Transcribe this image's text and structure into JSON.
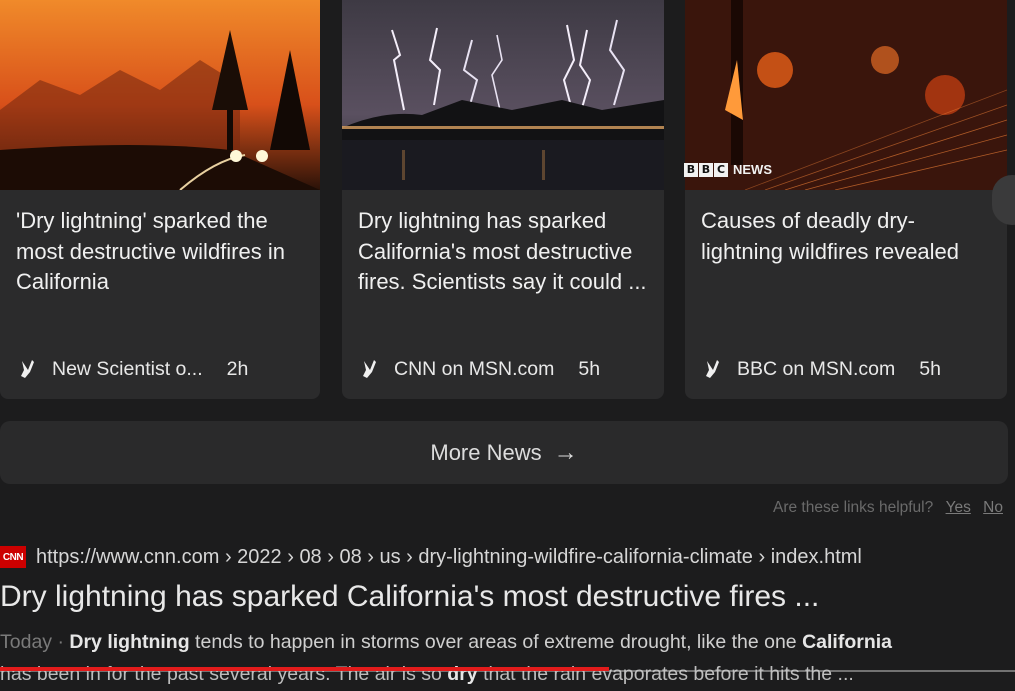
{
  "cards": [
    {
      "title": "'Dry lightning' sparked the most destructive wildfires in California",
      "source": "New Scientist o...",
      "age": "2h"
    },
    {
      "title": "Dry lightning has sparked California's most destructive fires. Scientists say it could ...",
      "source": "CNN on MSN.com",
      "age": "5h"
    },
    {
      "title": "Causes of deadly dry-lightning wildfires revealed",
      "source": "BBC on MSN.com",
      "age": "5h",
      "badge": [
        "B",
        "B",
        "C"
      ],
      "badge_text": "NEWS"
    }
  ],
  "more_news": {
    "label": "More News",
    "arrow": "→"
  },
  "feedback": {
    "question": "Are these links helpful?",
    "yes": "Yes",
    "no": "No"
  },
  "result": {
    "favicon": "CNN",
    "url": "https://www.cnn.com › 2022 › 08 › 08 › us › dry-lightning-wildfire-california-climate › index.html",
    "title": "Dry lightning has sparked California's most destructive fires ...",
    "date": "Today",
    "separator": " · ",
    "snippet_bold_1": "Dry lightning",
    "snippet_text_1": " tends to happen in storms over areas of extreme drought, like the one ",
    "snippet_bold_2": "California",
    "snippet_text_2a": "has been in for the past several years. The air is so ",
    "snippet_bold_3": "dry",
    "snippet_text_2b": " that the rain evaporates before it hits the ..."
  },
  "video_progress": 0.6,
  "colors": {
    "background": "#1c1c1d",
    "card": "#2b2b2c",
    "progress": "#e21b1b",
    "cnn_red": "#cc0000"
  }
}
